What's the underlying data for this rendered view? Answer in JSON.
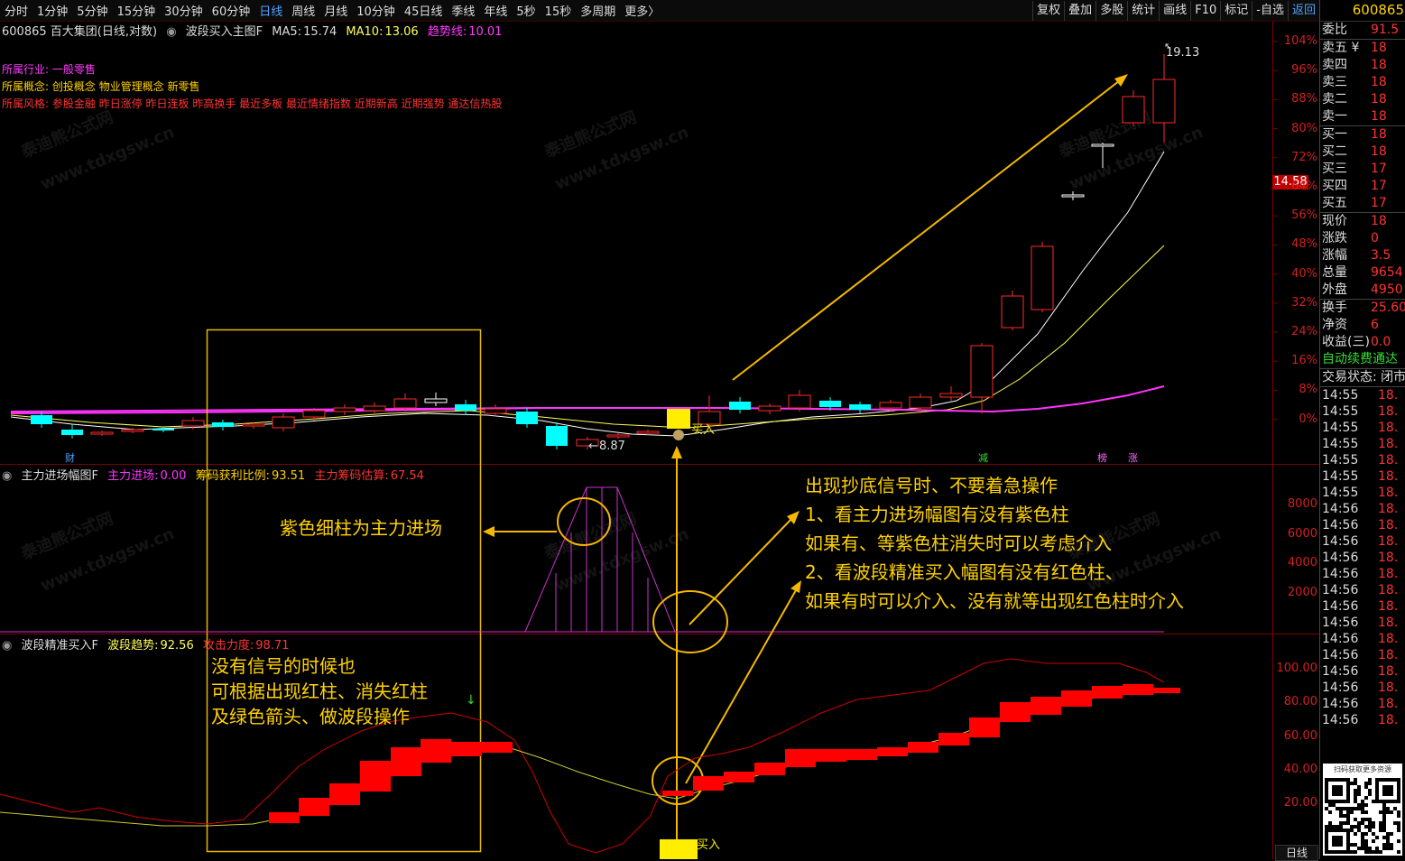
{
  "toolbar": {
    "timeframes": [
      "分时",
      "1分钟",
      "5分钟",
      "15分钟",
      "30分钟",
      "60分钟",
      "日线",
      "周线",
      "月线",
      "10分钟",
      "45日线",
      "季线",
      "年线",
      "5秒",
      "15秒",
      "多周期",
      "更多〉"
    ],
    "active": "日线",
    "right_buttons": [
      "复权",
      "叠加",
      "多股",
      "统计",
      "画线",
      "F10",
      "标记",
      "-自选",
      "返回"
    ]
  },
  "stock": {
    "code": "600865",
    "name": "600865 百大集团(日线,对数)",
    "main_indicator": "波段买入主图F",
    "ma5_label": "MA5:",
    "ma5": "15.74",
    "ma10_label": "MA10:",
    "ma10": "13.06",
    "trend_label": "趋势线:",
    "trend": "10.01",
    "industry_key": "所属行业:",
    "industry": "一般零售",
    "concept_key": "所属概念:",
    "concept": "创投概念 物业管理概念 新零售",
    "style_key": "所属风格:",
    "style": "参股金融 昨日涨停 昨日连板 昨高换手 最近多板 最近情绪指数 近期新高 近期强势 通达信热股",
    "price_tag": "14.58",
    "high_label": "19.13",
    "low_label": "8.87",
    "buy_label": "买入",
    "markers": [
      "财",
      "减",
      "榜",
      "涨"
    ]
  },
  "main_axis": [
    "104%",
    "96%",
    "88%",
    "80%",
    "72%",
    "64%",
    "56%",
    "48%",
    "40%",
    "32%",
    "24%",
    "16%",
    "8%",
    "0%"
  ],
  "ind1": {
    "name": "主力进场幅图F",
    "k1": "主力进场:",
    "v1": "0.00",
    "k2": "筹码获利比例:",
    "v2": "93.51",
    "k3": "主力筹码估算:",
    "v3": "67.54",
    "axis": [
      "8000",
      "6000",
      "4000",
      "2000"
    ]
  },
  "ind2": {
    "name": "波段精准买入F",
    "k1": "波段趋势:",
    "v1": "92.56",
    "k2": "攻击力度:",
    "v2": "98.71",
    "axis": [
      "100.00",
      "80.00",
      "60.00",
      "40.00",
      "20.00"
    ],
    "buy_label": "买入"
  },
  "annotations": {
    "purple": "紫色细柱为主力进场",
    "left_box": [
      "没有信号的时候也",
      "可根据出现红柱、消失红柱",
      "及绿色箭头、做波段操作"
    ],
    "right_text": [
      "出现抄底信号时、不要着急操作",
      "1、看主力进场幅图有没有紫色柱",
      "如果有、等紫色柱消失时可以考虑介入",
      "2、看波段精准买入幅图有没有红色柱、",
      "如果有时可以介入、没有就等出现红色柱时介入"
    ]
  },
  "watermark": [
    "泰迪熊公式网",
    "www.tdxgsw.cn"
  ],
  "bottom_tab": "日线",
  "sidebar": {
    "code": "600865",
    "weibi": {
      "k": "委比",
      "v": "91.5"
    },
    "asks": [
      {
        "k": "卖五 ¥",
        "v": "18"
      },
      {
        "k": "卖四",
        "v": "18"
      },
      {
        "k": "卖三",
        "v": "18"
      },
      {
        "k": "卖二",
        "v": "18"
      },
      {
        "k": "卖一",
        "v": "18"
      }
    ],
    "bids": [
      {
        "k": "买一",
        "v": "18"
      },
      {
        "k": "买二",
        "v": "18"
      },
      {
        "k": "买三",
        "v": "17"
      },
      {
        "k": "买四",
        "v": "17"
      },
      {
        "k": "买五",
        "v": "17"
      }
    ],
    "stats1": [
      {
        "k": "现价",
        "v": "18"
      },
      {
        "k": "涨跌",
        "v": "0"
      },
      {
        "k": "涨幅",
        "v": "3.5"
      },
      {
        "k": "总量",
        "v": "9654"
      },
      {
        "k": "外盘",
        "v": "4950"
      }
    ],
    "stats2": [
      {
        "k": "换手",
        "v": "25.60"
      },
      {
        "k": "净资",
        "v": "6"
      },
      {
        "k": "收益(三)",
        "v": "0.0"
      }
    ],
    "promo": "自动续费通达",
    "trade_state": "交易状态: 闭市",
    "ticks": [
      {
        "t": "14:55",
        "p": "18."
      },
      {
        "t": "14:55",
        "p": "18."
      },
      {
        "t": "14:55",
        "p": "18."
      },
      {
        "t": "14:55",
        "p": "18."
      },
      {
        "t": "14:55",
        "p": "18."
      },
      {
        "t": "14:55",
        "p": "18."
      },
      {
        "t": "14:55",
        "p": "18."
      },
      {
        "t": "14:56",
        "p": "18."
      },
      {
        "t": "14:56",
        "p": "18."
      },
      {
        "t": "14:56",
        "p": "18."
      },
      {
        "t": "14:56",
        "p": "18."
      },
      {
        "t": "14:56",
        "p": "18."
      },
      {
        "t": "14:56",
        "p": "18."
      },
      {
        "t": "14:56",
        "p": "18."
      },
      {
        "t": "14:56",
        "p": "18."
      },
      {
        "t": "14:56",
        "p": "18."
      },
      {
        "t": "14:56",
        "p": "18."
      },
      {
        "t": "14:56",
        "p": "18."
      },
      {
        "t": "14:56",
        "p": "18."
      },
      {
        "t": "14:56",
        "p": "18."
      },
      {
        "t": "14:56",
        "p": "18."
      }
    ],
    "qr_caption": "扫码获取更多资源"
  }
}
